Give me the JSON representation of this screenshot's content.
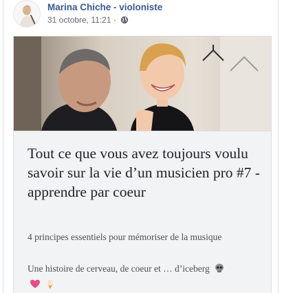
{
  "post": {
    "author": "Marina Chiche - violoniste",
    "timestamp": "31 octobre, 11:21 ·",
    "audience_icon": "globe-icon"
  },
  "link": {
    "title": "Tout ce que vous avez toujours voulu savoir sur la vie d’un musicien pro #7 -apprendre par coeur",
    "description_1": "4 principes essentiels pour mémoriser de la musique",
    "description_2": "Une histoire de cerveau, de coeur et … d’iceberg",
    "emojis": [
      "skull-emoji",
      "heart-emoji",
      "ice-cream-emoji"
    ]
  },
  "colors": {
    "author": "#385898",
    "meta": "#616770",
    "title": "#1d2129",
    "info_bg": "#f2f3f5"
  }
}
